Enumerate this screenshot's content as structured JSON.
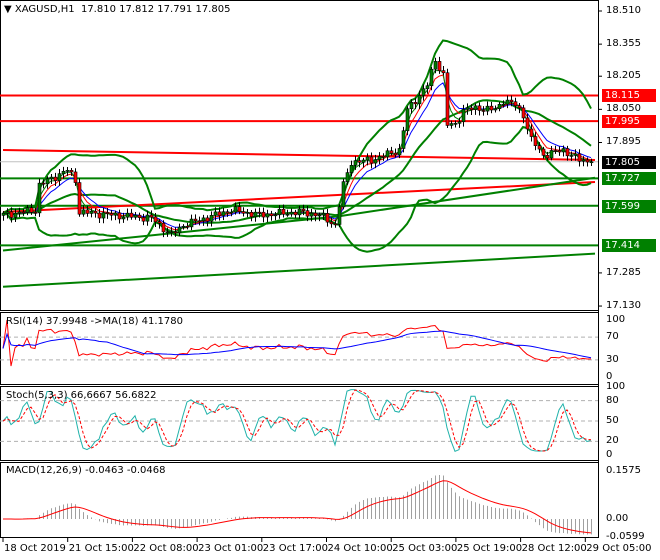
{
  "header": {
    "symbol": "XAGUSD,H1",
    "ohlc": "17.810 17.812 17.791 17.805"
  },
  "panes": {
    "rsi": {
      "title": "RSI(14) 37.9948  ->MA(18) 41.1780"
    },
    "stoch": {
      "title": "Stoch(5,3,3) 66,6667 56.6822"
    },
    "macd": {
      "title": "MACD(12,26,9) -0.0463 -0.0468"
    }
  },
  "colors": {
    "up": "#008000",
    "down": "#ff0000",
    "level_red": "#ff0000",
    "level_green": "#008000",
    "bands": "#008000",
    "rsi": "#ff0000",
    "rsi_ma": "#0000ff",
    "stoch_k": "#20b2aa",
    "stoch_d": "#ff0000",
    "macd_hist": "#a0a0a0"
  },
  "chart_data": {
    "type": "candlestick",
    "title": "XAGUSD,H1",
    "price_axis": {
      "ticks": [
        "18.510",
        "18.355",
        "18.205",
        "18.050",
        "17.895",
        "17.285",
        "17.130"
      ],
      "range": [
        17.13,
        18.51
      ]
    },
    "levels": [
      {
        "price": 17.805,
        "label": "17.805",
        "color": "#000000",
        "kind": "current"
      },
      {
        "price": 18.115,
        "label": "18.115",
        "color": "#ff0000"
      },
      {
        "price": 17.995,
        "label": "17.995",
        "color": "#ff0000"
      },
      {
        "price": 17.727,
        "label": "17.727",
        "color": "#008000"
      },
      {
        "price": 17.599,
        "label": "17.599",
        "color": "#008000"
      },
      {
        "price": 17.414,
        "label": "17.414",
        "color": "#008000"
      }
    ],
    "trendlines": [
      {
        "color": "#ff0000",
        "from": [
          0,
          17.86
        ],
        "to": [
          148,
          17.813
        ]
      },
      {
        "color": "#ff0000",
        "from": [
          0,
          17.57
        ],
        "to": [
          148,
          17.71
        ]
      },
      {
        "color": "#008000",
        "from": [
          0,
          17.39
        ],
        "to": [
          84,
          17.55
        ]
      },
      {
        "color": "#008000",
        "from": [
          84,
          17.55
        ],
        "to": [
          148,
          17.73
        ]
      },
      {
        "color": "#008000",
        "from": [
          0,
          17.22
        ],
        "to": [
          148,
          17.375
        ]
      }
    ],
    "key_closes": [
      [
        0,
        17.556
      ],
      [
        8,
        17.579
      ],
      [
        9,
        17.696
      ],
      [
        16,
        17.766
      ],
      [
        18,
        17.72
      ],
      [
        19,
        17.57
      ],
      [
        27,
        17.556
      ],
      [
        37,
        17.542
      ],
      [
        42,
        17.462
      ],
      [
        45,
        17.509
      ],
      [
        49,
        17.532
      ],
      [
        57,
        17.579
      ],
      [
        64,
        17.556
      ],
      [
        74,
        17.57
      ],
      [
        79,
        17.556
      ],
      [
        83,
        17.509
      ],
      [
        85,
        17.696
      ],
      [
        87,
        17.804
      ],
      [
        92,
        17.813
      ],
      [
        99,
        17.86
      ],
      [
        101,
        18.047
      ],
      [
        104,
        18.117
      ],
      [
        106,
        18.164
      ],
      [
        108,
        18.281
      ],
      [
        110,
        18.211
      ],
      [
        111,
        17.977
      ],
      [
        113,
        17.977
      ],
      [
        115,
        18.047
      ],
      [
        119,
        18.056
      ],
      [
        123,
        18.047
      ],
      [
        125,
        18.094
      ],
      [
        128,
        18.07
      ],
      [
        130,
        18.024
      ],
      [
        132,
        17.907
      ],
      [
        135,
        17.836
      ],
      [
        140,
        17.86
      ],
      [
        144,
        17.813
      ],
      [
        147,
        17.805
      ]
    ],
    "bars": 148,
    "x_ticks": [
      "18 Oct 2019",
      "21 Oct 15:00",
      "22 Oct 08:00",
      "23 Oct 01:00",
      "23 Oct 17:00",
      "24 Oct 10:00",
      "25 Oct 03:00",
      "25 Oct 19:00",
      "28 Oct 12:00",
      "29 Oct 05:00"
    ],
    "rsi_axis": [
      "100",
      "70",
      "30",
      "0"
    ],
    "stoch_axis": [
      "100",
      "80",
      "50",
      "20",
      "0"
    ],
    "macd_axis": [
      "0.1575",
      "0.00",
      "-0.0599"
    ]
  }
}
